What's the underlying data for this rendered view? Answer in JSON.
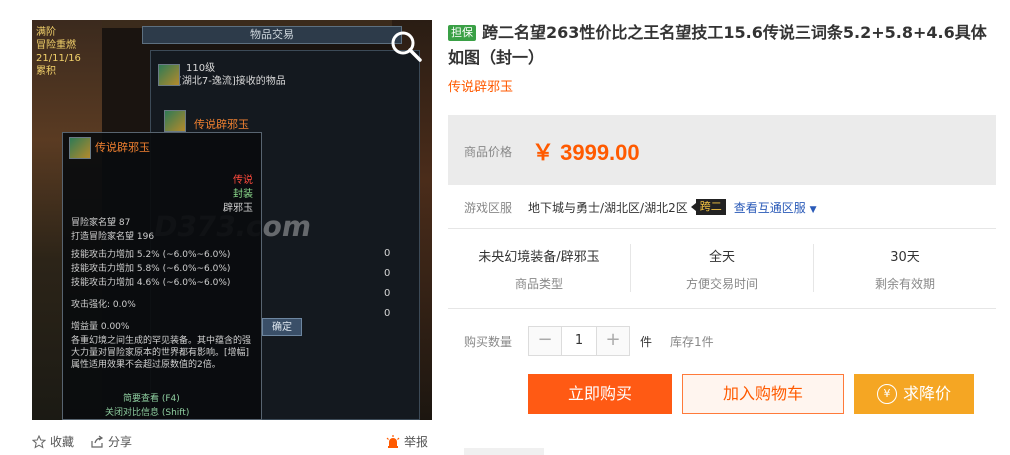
{
  "screenshot": {
    "window_title": "物品交易",
    "top_left_text": [
      "满阶",
      "冒险重燃",
      "21/11/16",
      "累积"
    ],
    "seller_level": "110级",
    "seller_text": "玩家[湖北7-逸流]接收的物品",
    "item_name": "传说辟邪玉",
    "tooltip": {
      "name": "传说辟邪玉",
      "rarity": "传说",
      "bound": "封装",
      "type": "辟邪玉",
      "fame": "冒险家名望 87",
      "fame2": "打造冒险家名望 196",
      "skill_lines": [
        "技能攻击力增加 5.2% (~6.0%~6.0%)",
        "技能攻击力增加 5.8% (~6.0%~6.0%)",
        "技能攻击力增加 4.6% (~6.0%~6.0%)"
      ],
      "enhance": "攻击强化: 0.0%",
      "gain": "增益量 0.00%",
      "desc": "各重幻境之间生成的罕见装备。其中蕴含的强大力量对冒险家原本的世界都有影响。[增幅]属性适用效果不会超过原数值的2倍。",
      "hint1": "简要查看 (F4)",
      "hint2": "关闭对比信息 (Shift)"
    },
    "confirm_label": "确定",
    "watermark": "D373.com",
    "zeros": [
      "0",
      "0",
      "0",
      "0"
    ]
  },
  "actions": {
    "favorite": "收藏",
    "share": "分享",
    "report": "举报"
  },
  "product": {
    "guarantee_badge": "担保",
    "title": "跨二名望263性价比之王名望技工15.6传说三词条5.2+5.8+4.6具体如图（封一）",
    "subtitle": "传说辟邪玉"
  },
  "price": {
    "label": "商品价格",
    "value": "￥ 3999.00"
  },
  "server": {
    "label": "游戏区服",
    "value": "地下城与勇士/湖北区/湖北2区",
    "cross_badge": "跨二",
    "link": "查看互通区服"
  },
  "stats": [
    {
      "value": "未央幻境装备/辟邪玉",
      "label": "商品类型"
    },
    {
      "value": "全天",
      "label": "方便交易时间"
    },
    {
      "value": "30天",
      "label": "剩余有效期"
    }
  ],
  "quantity": {
    "label": "购买数量",
    "minus": "−",
    "value": "1",
    "plus": "+",
    "unit": "件",
    "stock": "库存1件"
  },
  "buttons": {
    "buy": "立即购买",
    "cart": "加入购物车",
    "bargain": "求降价",
    "bargain_icon": "¥"
  },
  "colors": {
    "accent": "#ff5a00",
    "buy_bg": "#ff5a14",
    "bargain_bg": "#f5a623",
    "guarantee_bg": "#3aa046"
  }
}
